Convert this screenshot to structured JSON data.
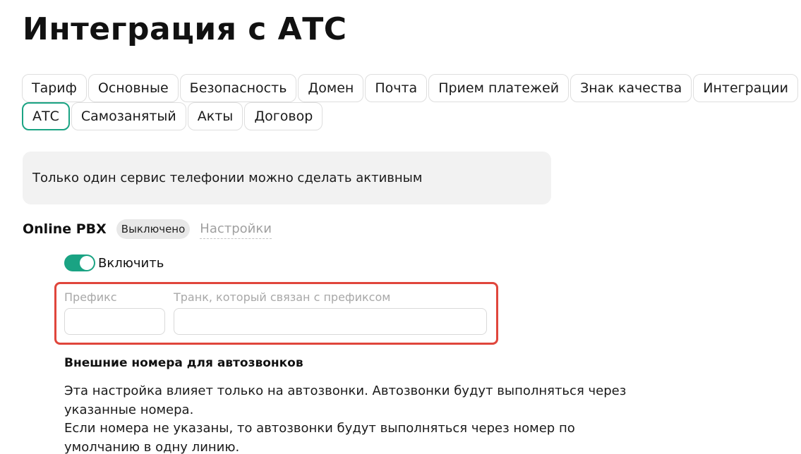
{
  "page": {
    "title": "Интеграция с АТС"
  },
  "tabs_row1": [
    "Тариф",
    "Основные",
    "Безопасность",
    "Домен",
    "Почта",
    "Прием платежей",
    "Знак качества",
    "Интеграции"
  ],
  "tabs_row2": [
    "АТС",
    "Самозанятый",
    "Акты",
    "Договор"
  ],
  "active_tab": "АТС",
  "notice": {
    "text": "Только один сервис телефонии можно сделать активным"
  },
  "service": {
    "name": "Online PBX",
    "status": "Выключено",
    "settings_link": "Настройки"
  },
  "toggle": {
    "label": "Включить",
    "on": true
  },
  "fields": {
    "prefix_label": "Префикс",
    "prefix_value": "",
    "trunk_label": "Транк, который связан с префиксом",
    "trunk_value": ""
  },
  "external_numbers": {
    "title": "Внешние номера для автозвонков",
    "line1": "Эта настройка влияет только на автозвонки. Автозвонки будут выполняться через",
    "line2": "указанные номера.",
    "line3": "Если номера не указаны, то автозвонки будут выполняться через номер по",
    "line4": "умолчанию в одну линию."
  },
  "colors": {
    "accent": "#1aa383",
    "highlight": "#e0463c",
    "notice_bg": "#f2f2f2"
  }
}
